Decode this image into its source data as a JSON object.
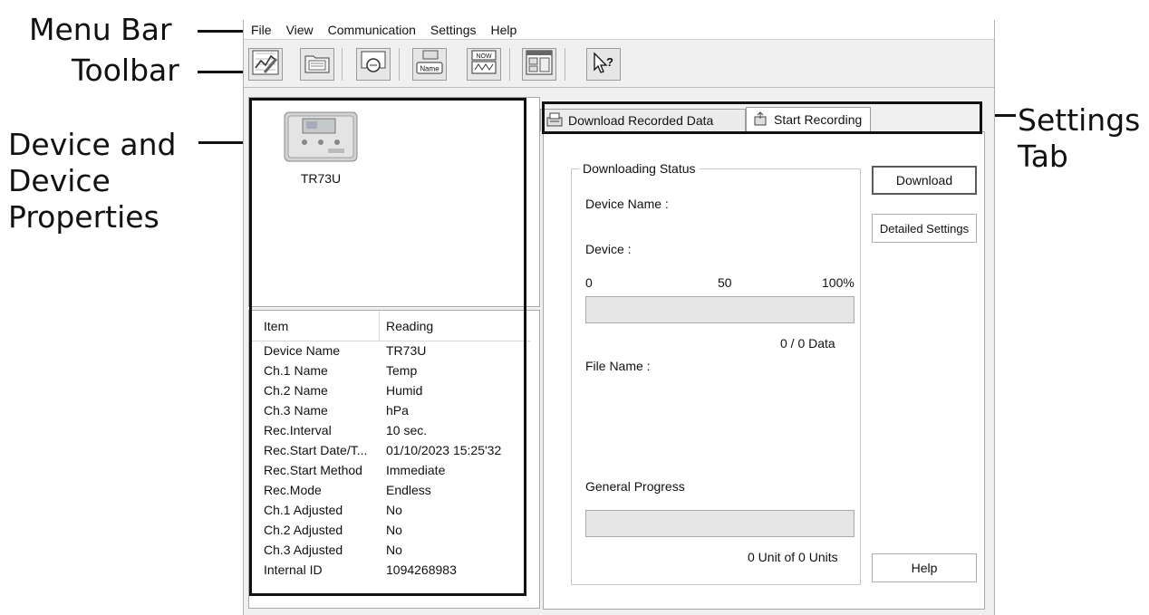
{
  "callouts": {
    "menu_bar": "Menu Bar",
    "toolbar": "Toolbar",
    "device_line1": "Device and",
    "device_line2": "Device",
    "device_line3": "Properties",
    "settings_line1": "Settings",
    "settings_line2": "Tab"
  },
  "menu": [
    "File",
    "View",
    "Communication",
    "Settings",
    "Help"
  ],
  "toolbar": {
    "tools": [
      {
        "icon": "graph-icon"
      },
      {
        "icon": "folder-icon"
      },
      {
        "icon": "monitor-search-icon"
      },
      {
        "icon": "device-name-icon",
        "badge": "Name"
      },
      {
        "icon": "current-readings-icon",
        "badge": "NOW"
      },
      {
        "icon": "settings-panel-icon"
      },
      {
        "icon": "help-cursor-icon"
      }
    ]
  },
  "device": {
    "name": "TR73U",
    "icon": "data-logger-icon"
  },
  "properties": {
    "col_item": "Item",
    "col_reading": "Reading",
    "rows": [
      {
        "item": "Device Name",
        "reading": "TR73U"
      },
      {
        "item": "Ch.1 Name",
        "reading": "Temp"
      },
      {
        "item": "Ch.2 Name",
        "reading": "Humid"
      },
      {
        "item": "Ch.3 Name",
        "reading": "hPa"
      },
      {
        "item": "Rec.Interval",
        "reading": "10 sec."
      },
      {
        "item": "Rec.Start Date/T...",
        "reading": "01/10/2023 15:25'32"
      },
      {
        "item": "Rec.Start Method",
        "reading": "Immediate"
      },
      {
        "item": "Rec.Mode",
        "reading": "Endless"
      },
      {
        "item": "Ch.1 Adjusted",
        "reading": "No"
      },
      {
        "item": "Ch.2 Adjusted",
        "reading": "No"
      },
      {
        "item": "Ch.3 Adjusted",
        "reading": "No"
      },
      {
        "item": "Internal ID",
        "reading": "1094268983"
      }
    ]
  },
  "tabs": [
    {
      "label": "Download Recorded Data",
      "icon": "download-data-icon",
      "active": true
    },
    {
      "label": "Start Recording",
      "icon": "start-recording-icon",
      "active": false
    }
  ],
  "download": {
    "group_title": "Downloading Status",
    "device_name_label": "Device Name :",
    "device_label": "Device :",
    "scale_min": "0",
    "scale_mid": "50",
    "scale_max": "100%",
    "device_progress_fraction": 0,
    "data_count": "0 / 0 Data",
    "file_name_label": "File Name :",
    "general_progress_label": "General Progress",
    "general_progress_fraction": 0,
    "units_count": "0 Unit of 0 Units"
  },
  "buttons": {
    "download": "Download",
    "detailed_settings": "Detailed Settings",
    "help": "Help"
  }
}
